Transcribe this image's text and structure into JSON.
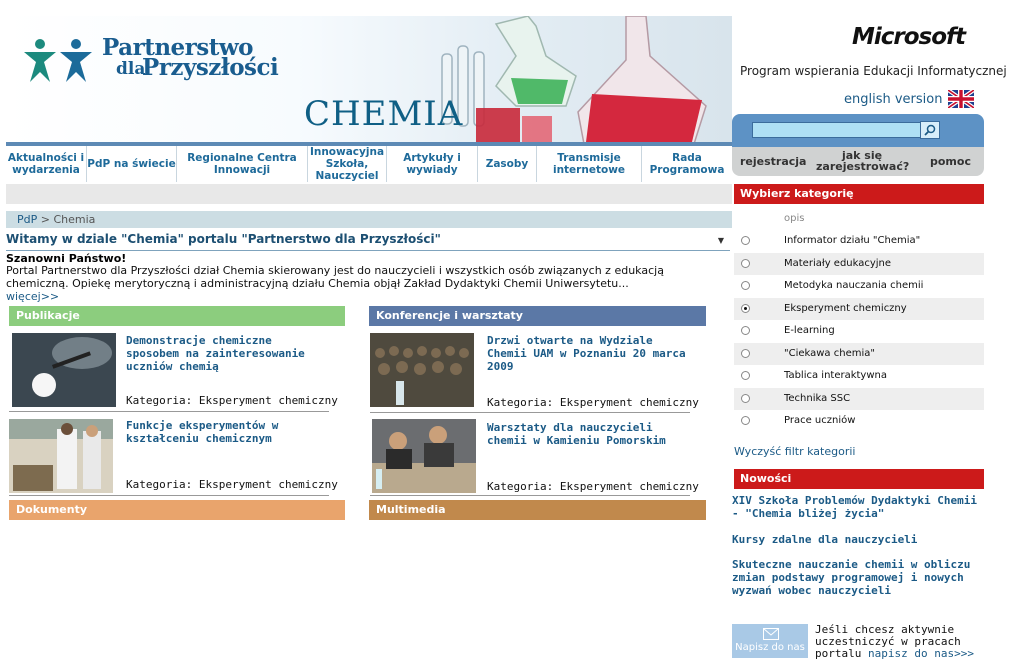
{
  "header": {
    "logo_line1": "Partnerstwo",
    "logo_line2a": "dla",
    "logo_line2b": "Przyszłości",
    "section_title": "CHEMIA",
    "ms_logo": "Microsoft",
    "ms_program": "Program wspierania Edukacji Informatycznej",
    "english_version": "english version"
  },
  "search": {
    "placeholder": ""
  },
  "login": {
    "register": "rejestracja",
    "how_to_register": "jak się zarejestrować?",
    "help": "pomoc"
  },
  "nav": [
    "Aktualności i wydarzenia",
    "PdP na świecie",
    "Regionalne Centra Innowacji",
    "Innowacyjna Szkoła, Nauczyciel",
    "Artykuły i wywiady",
    "Zasoby",
    "Transmisje internetowe",
    "Rada Programowa"
  ],
  "breadcrumb": {
    "home": "PdP",
    "sep": ">",
    "current": "Chemia"
  },
  "welcome": "Witamy w dziale \"Chemia\" portalu \"Partnerstwo dla Przyszłości\"",
  "intro": {
    "greeting": "Szanowni Państwo!",
    "text": "Portal Partnerstwo dla Przyszłości dział Chemia skierowany jest do nauczycieli i wszystkich osób związanych z edukacją chemiczną. Opiekę merytoryczną i administracyjną działu Chemia objął Zakład Dydaktyki Chemii Uniwersytetu...",
    "more": "więcej>>"
  },
  "sections": {
    "publications": {
      "title": "Publikacje",
      "color": "#8ccd7e",
      "items": [
        {
          "title": "Demonstracje chemiczne sposobem na zainteresowanie uczniów chemią",
          "category": "Kategoria: Eksperyment chemiczny"
        },
        {
          "title": "Funkcje eksperymentów w kształceniu chemicznym",
          "category": "Kategoria: Eksperyment chemiczny"
        }
      ]
    },
    "conferences": {
      "title": "Konferencje i warsztaty",
      "color": "#5b78a6",
      "items": [
        {
          "title": "Drzwi otwarte na Wydziale Chemii UAM w Poznaniu 20 marca 2009",
          "category": "Kategoria: Eksperyment chemiczny"
        },
        {
          "title": "Warsztaty dla nauczycieli chemii w Kamieniu Pomorskim",
          "category": "Kategoria: Eksperyment chemiczny"
        }
      ]
    },
    "documents": {
      "title": "Dokumenty",
      "color": "#e9a46c"
    },
    "multimedia": {
      "title": "Multimedia",
      "color": "#c1894c"
    }
  },
  "categories": {
    "title": "Wybierz kategorię",
    "column_header": "opis",
    "items": [
      {
        "label": "Informator działu \"Chemia\"",
        "selected": false
      },
      {
        "label": "Materiały edukacyjne",
        "selected": false
      },
      {
        "label": "Metodyka nauczania chemii",
        "selected": false
      },
      {
        "label": "Eksperyment chemiczny",
        "selected": true
      },
      {
        "label": "E-learning",
        "selected": false
      },
      {
        "label": "\"Ciekawa chemia\"",
        "selected": false
      },
      {
        "label": "Tablica interaktywna",
        "selected": false
      },
      {
        "label": "Technika SSC",
        "selected": false
      },
      {
        "label": "Prace uczniów",
        "selected": false
      }
    ],
    "clear": "Wyczyść filtr kategorii"
  },
  "news": {
    "title": "Nowości",
    "items": [
      "XIV Szkoła Problemów Dydaktyki Chemii - \"Chemia bliżej życia\"",
      "Kursy zdalne dla nauczycieli",
      "Skuteczne nauczanie chemii w obliczu zmian podstawy programowej i nowych wyzwań wobec nauczycieli"
    ]
  },
  "contact": {
    "button": "Napisz do nas",
    "text": "Jeśli chcesz aktywnie uczestniczyć w pracach portalu",
    "link": "napisz do nas>>>"
  },
  "colors": {
    "accent_blue": "#1b5a86",
    "red_header": "#cc1a1a",
    "nav_text": "#1e6a9a"
  }
}
